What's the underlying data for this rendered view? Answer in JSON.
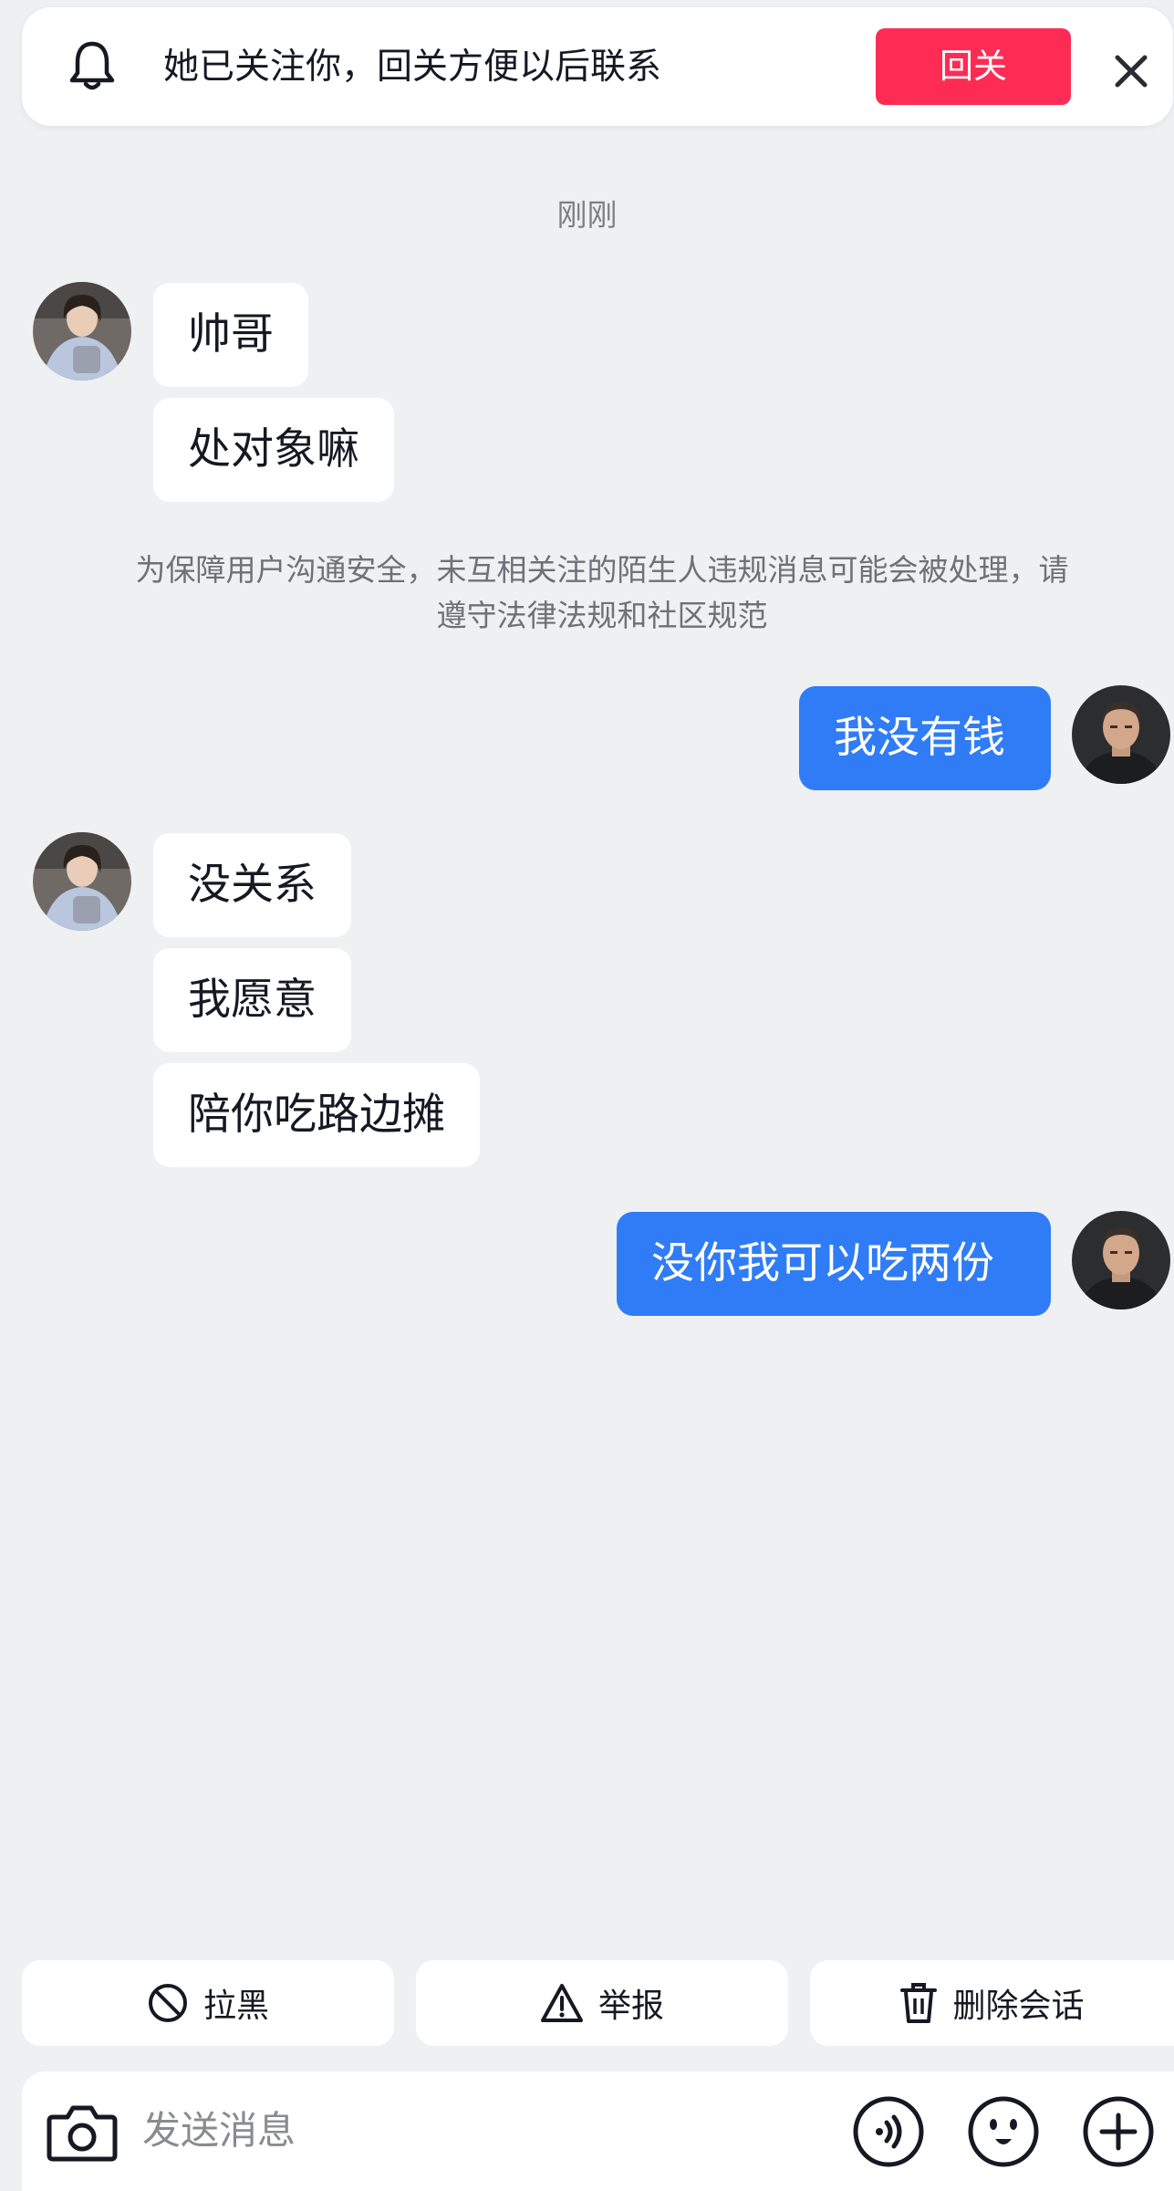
{
  "banner": {
    "text": "她已关注你，回关方便以后联系",
    "follow_back_label": "回关",
    "icons": {
      "bell": "bell-icon",
      "close": "close-icon"
    },
    "accent_color": "#fe2c55"
  },
  "timestamp": "刚刚",
  "notice": "为保障用户沟通安全，未互相关注的陌生人违规消息可能会被处理，请遵守法律法规和社区规范",
  "messages": [
    {
      "side": "in",
      "text": "帅哥"
    },
    {
      "side": "in",
      "text": "处对象嘛"
    },
    {
      "side": "out",
      "text": "我没有钱"
    },
    {
      "side": "in",
      "text": "没关系"
    },
    {
      "side": "in",
      "text": "我愿意"
    },
    {
      "side": "in",
      "text": "陪你吃路边摊"
    },
    {
      "side": "out",
      "text": "没你我可以吃两份"
    }
  ],
  "colors": {
    "outgoing_bubble": "#2f7cf6",
    "incoming_bubble": "#ffffff",
    "background": "#eef0f2"
  },
  "actions": [
    {
      "label": "拉黑",
      "icon": "block-icon"
    },
    {
      "label": "举报",
      "icon": "warning-icon"
    },
    {
      "label": "删除会话",
      "icon": "trash-icon"
    }
  ],
  "input": {
    "placeholder": "发送消息",
    "icons": [
      "camera-icon",
      "voice-icon",
      "emoji-icon",
      "plus-icon"
    ]
  }
}
